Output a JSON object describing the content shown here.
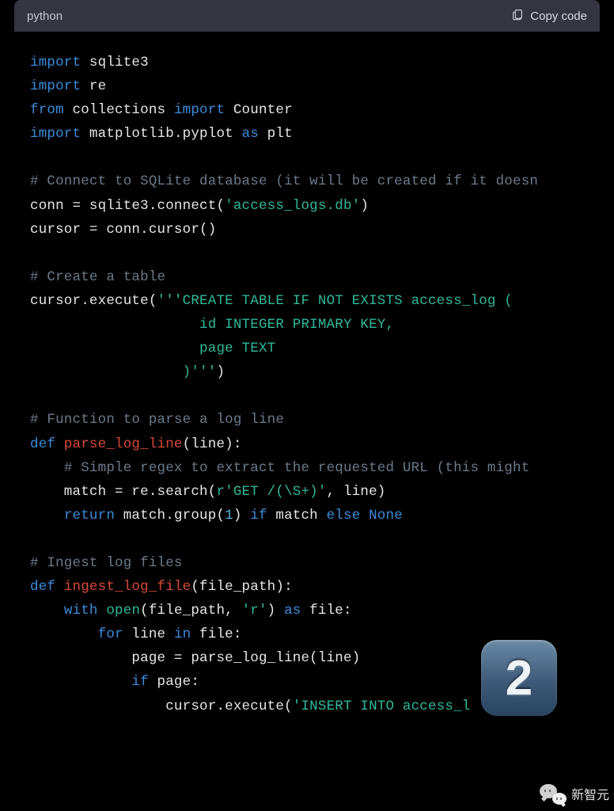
{
  "header": {
    "language": "python",
    "copy_label": "Copy code"
  },
  "code": {
    "lines": [
      [
        [
          "kw",
          "import"
        ],
        [
          "",
          ""
        ],
        [
          "mod",
          " sqlite3"
        ]
      ],
      [
        [
          "kw",
          "import"
        ],
        [
          "mod",
          " re"
        ]
      ],
      [
        [
          "kw",
          "from"
        ],
        [
          "mod",
          " collections "
        ],
        [
          "kw",
          "import"
        ],
        [
          "mod",
          " Counter"
        ]
      ],
      [
        [
          "kw",
          "import"
        ],
        [
          "mod",
          " matplotlib.pyplot "
        ],
        [
          "kw",
          "as"
        ],
        [
          "mod",
          " plt"
        ]
      ],
      [
        [
          "",
          " "
        ]
      ],
      [
        [
          "comment",
          "# Connect to SQLite database (it will be created if it doesn"
        ]
      ],
      [
        [
          "mod",
          "conn = sqlite3.connect("
        ],
        [
          "str",
          "'access_logs.db'"
        ],
        [
          "mod",
          ")"
        ]
      ],
      [
        [
          "mod",
          "cursor = conn.cursor()"
        ]
      ],
      [
        [
          "",
          " "
        ]
      ],
      [
        [
          "comment",
          "# Create a table"
        ]
      ],
      [
        [
          "mod",
          "cursor.execute("
        ],
        [
          "str",
          "'''CREATE TABLE IF NOT EXISTS access_log ("
        ]
      ],
      [
        [
          "str",
          "                    id INTEGER PRIMARY KEY,"
        ]
      ],
      [
        [
          "str",
          "                    page TEXT"
        ]
      ],
      [
        [
          "str",
          "                  )'''"
        ],
        [
          "mod",
          ")"
        ]
      ],
      [
        [
          "",
          " "
        ]
      ],
      [
        [
          "comment",
          "# Function to parse a log line"
        ]
      ],
      [
        [
          "kw",
          "def"
        ],
        [
          "mod",
          " "
        ],
        [
          "func",
          "parse_log_line"
        ],
        [
          "mod",
          "(line):"
        ]
      ],
      [
        [
          "mod",
          "    "
        ],
        [
          "comment",
          "# Simple regex to extract the requested URL (this might "
        ]
      ],
      [
        [
          "mod",
          "    match = re.search("
        ],
        [
          "str",
          "r'GET /(\\S+)'"
        ],
        [
          "mod",
          ", line)"
        ]
      ],
      [
        [
          "mod",
          "    "
        ],
        [
          "kw",
          "return"
        ],
        [
          "mod",
          " match.group("
        ],
        [
          "num",
          "1"
        ],
        [
          "mod",
          ") "
        ],
        [
          "kw",
          "if"
        ],
        [
          "mod",
          " match "
        ],
        [
          "kw",
          "else"
        ],
        [
          "mod",
          " "
        ],
        [
          "none",
          "None"
        ]
      ],
      [
        [
          "",
          " "
        ]
      ],
      [
        [
          "comment",
          "# Ingest log files"
        ]
      ],
      [
        [
          "kw",
          "def"
        ],
        [
          "mod",
          " "
        ],
        [
          "func",
          "ingest_log_file"
        ],
        [
          "mod",
          "(file_path):"
        ]
      ],
      [
        [
          "mod",
          "    "
        ],
        [
          "kw",
          "with"
        ],
        [
          "mod",
          " "
        ],
        [
          "builtin",
          "open"
        ],
        [
          "mod",
          "(file_path, "
        ],
        [
          "str",
          "'r'"
        ],
        [
          "mod",
          ") "
        ],
        [
          "kw",
          "as"
        ],
        [
          "mod",
          " file:"
        ]
      ],
      [
        [
          "mod",
          "        "
        ],
        [
          "kw",
          "for"
        ],
        [
          "mod",
          " line "
        ],
        [
          "kw",
          "in"
        ],
        [
          "mod",
          " file:"
        ]
      ],
      [
        [
          "mod",
          "            page = parse_log_line(line)"
        ]
      ],
      [
        [
          "mod",
          "            "
        ],
        [
          "kw",
          "if"
        ],
        [
          "mod",
          " page:"
        ]
      ],
      [
        [
          "mod",
          "                cursor.execute("
        ],
        [
          "str",
          "'INSERT INTO access_l"
        ]
      ]
    ]
  },
  "float_icon": {
    "digit": "2"
  },
  "wechat_badge": {
    "label": "新智元"
  }
}
